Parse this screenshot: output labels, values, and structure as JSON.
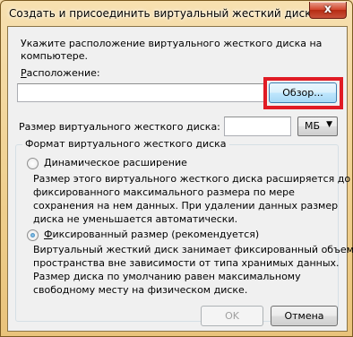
{
  "window": {
    "title": "Создать и присоединить виртуальный жесткий диск",
    "close_glyph": "x"
  },
  "intro": {
    "line1": "Укажите расположение виртуального жесткого диска на",
    "line2": "компьютере."
  },
  "location": {
    "label": "Расположение:",
    "value": "",
    "browse_label": "Обзор..."
  },
  "size": {
    "label": "Размер виртуального жесткого диска:",
    "value": "",
    "unit": "МБ"
  },
  "format": {
    "group_title": "Формат виртуального жесткого диска",
    "dynamic": {
      "label": "Динамическое расширение",
      "desc": [
        "Размер этого виртуального жесткого диска расширяется до",
        "фиксированного максимального размера по мере",
        "сохранения на нем данных. При удалении данных размер",
        "диска не уменьшается автоматически."
      ]
    },
    "fixed": {
      "label": "Фиксированный размер (рекомендуется)",
      "desc": [
        "Виртуальный жесткий диск занимает фиксированный объем",
        "пространства вне зависимости от типа хранимых данных.",
        "Размер диска по умолчанию равен максимальному",
        "свободному месту на физическом диске."
      ]
    },
    "selected": "fixed"
  },
  "buttons": {
    "ok": "OK",
    "cancel": "Отмена"
  }
}
